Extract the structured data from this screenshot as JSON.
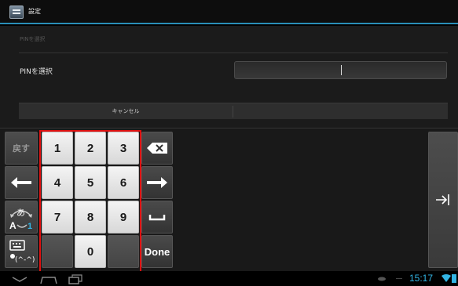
{
  "action_bar": {
    "title": "設定",
    "icon": "settings-app-icon"
  },
  "dialog": {
    "title": "PINを選択",
    "pin_label": "PINを選択",
    "pin_value": "",
    "cancel_label": "キャンセル"
  },
  "keyboard": {
    "back_label": "戻す",
    "digits": [
      "1",
      "2",
      "3",
      "4",
      "5",
      "6",
      "7",
      "8",
      "9",
      "0"
    ],
    "done_label": "Done",
    "kana_top": "あ",
    "kana_bottom": "A",
    "kana_digit": "1",
    "emoticon_label": "(^-^)",
    "icons": [
      "backspace-icon",
      "arrow-left-icon",
      "arrow-right-icon",
      "space-icon",
      "tab-icon",
      "keyboard-icon"
    ]
  },
  "status_bar": {
    "time": "15:17",
    "accent": "#33b5e5"
  },
  "highlight_color": "#e01010"
}
